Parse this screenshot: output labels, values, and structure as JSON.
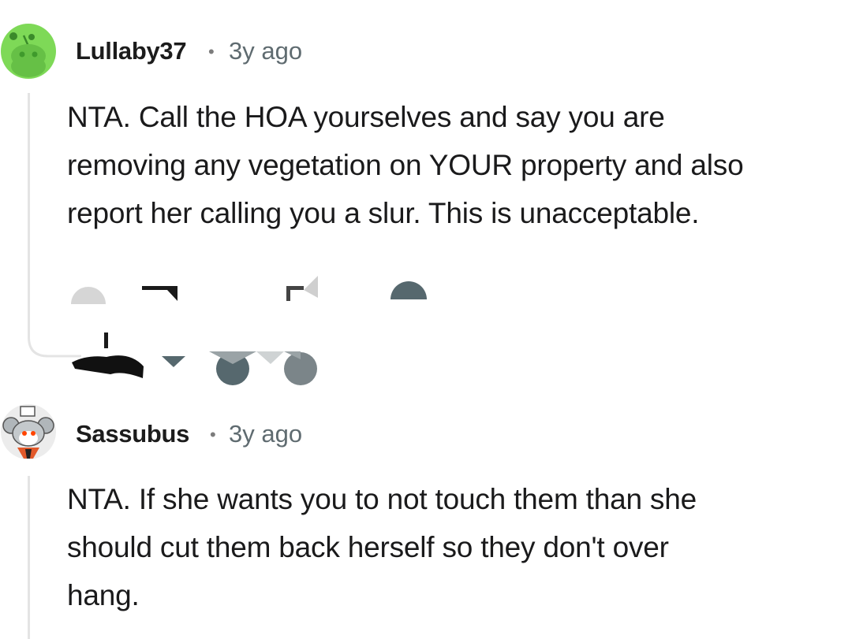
{
  "comments": [
    {
      "username": "Lullaby37",
      "separator": "•",
      "timestamp": "3y ago",
      "avatar": {
        "icon": "snoo-avatar-green",
        "bg_color": "#7ed957"
      },
      "lines": [
        "NTA. Call the HOA yourselves and say you are",
        "removing any vegetation on YOUR property and also",
        "report her calling you a slur. This is unacceptable."
      ]
    },
    {
      "username": "Sassubus",
      "separator": "•",
      "timestamp": "3y ago",
      "avatar": {
        "icon": "snoo-avatar-koala",
        "bg_color": "#ececec"
      },
      "lines": [
        "NTA. If she wants you to not touch them than she",
        "should cut them back herself so they don't over",
        "hang."
      ]
    }
  ],
  "colors": {
    "thread_line": "#e4e4e4",
    "username": "#1c1c1c",
    "meta": "#5f6b70"
  }
}
